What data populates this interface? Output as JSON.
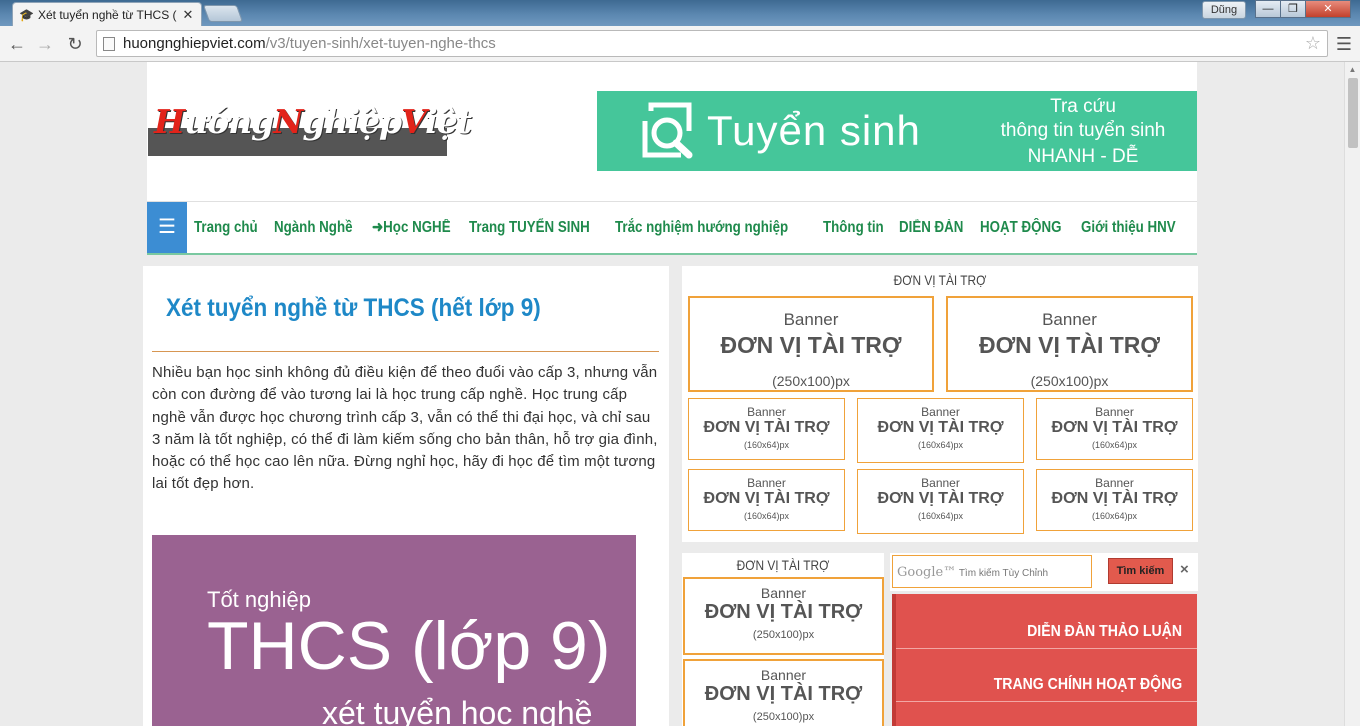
{
  "browser": {
    "tab_title": "Xét tuyển nghề từ THCS (",
    "tab_icon": "graduation-cap-icon",
    "user_name": "Dũng",
    "url_host": "huongnghiepviet.com",
    "url_path": "/v3/tuyen-sinh/xet-tuyen-nghe-thcs",
    "window_controls": [
      "—",
      "❐",
      "✕"
    ]
  },
  "site": {
    "logo_text_parts": [
      "H",
      "ướng",
      "N",
      "ghiệp",
      "V",
      "iệt"
    ],
    "ad": {
      "title": "Tuyển sinh",
      "line1": "Tra cứu",
      "line2": "thông tin tuyển sinh",
      "line3": "NHANH - DỄ",
      "color": "#45c69a"
    },
    "nav": [
      "Trang chủ",
      "Ngành Nghề",
      "Học NGHỀ",
      "Trang TUYỂN SINH",
      "Trắc nghiệm hướng nghiệp",
      "Thông tin",
      "DIỄN ĐÀN",
      "HOẠT ĐỘNG",
      "Giới thiệu HNV"
    ]
  },
  "article": {
    "title": "Xét tuyển nghề từ THCS (hết lớp 9)",
    "intro": "Nhiều bạn học sinh không đủ điều kiện để theo đuổi vào cấp 3, nhưng vẫn còn con đường để vào tương lai là học trung cấp nghề. Học trung cấp nghề vẫn được học chương trình cấp 3, vẫn có thể thi đại học, và chỉ sau 3 năm là tốt nghiệp, có thể đi làm kiếm sống cho bản thân, hỗ trợ gia đình, hoặc có thể học cao lên nữa. Đừng nghỉ học, hãy đi học để tìm một tương lai tốt đẹp hơn.",
    "hero_small": "Tốt nghiệp",
    "hero_big": "THCS (lớp 9)",
    "hero_sub": "xét tuyển học nghề"
  },
  "sponsors": {
    "heading": "ĐƠN VỊ TÀI TRỢ",
    "banner_word": "Banner",
    "sponsor_text": "ĐƠN VỊ TÀI TRỢ",
    "size_big": "(250x100)px",
    "size_small": "(160x64)px"
  },
  "search": {
    "brand": "Google™",
    "placeholder": "Tìm kiếm Tùy Chỉnh",
    "button": "Tìm kiếm",
    "clear": "×"
  },
  "forum": {
    "items": [
      "DIỄN ĐÀN THẢO LUẬN",
      "TRANG CHÍNH HOẠT ĐỘNG"
    ]
  }
}
